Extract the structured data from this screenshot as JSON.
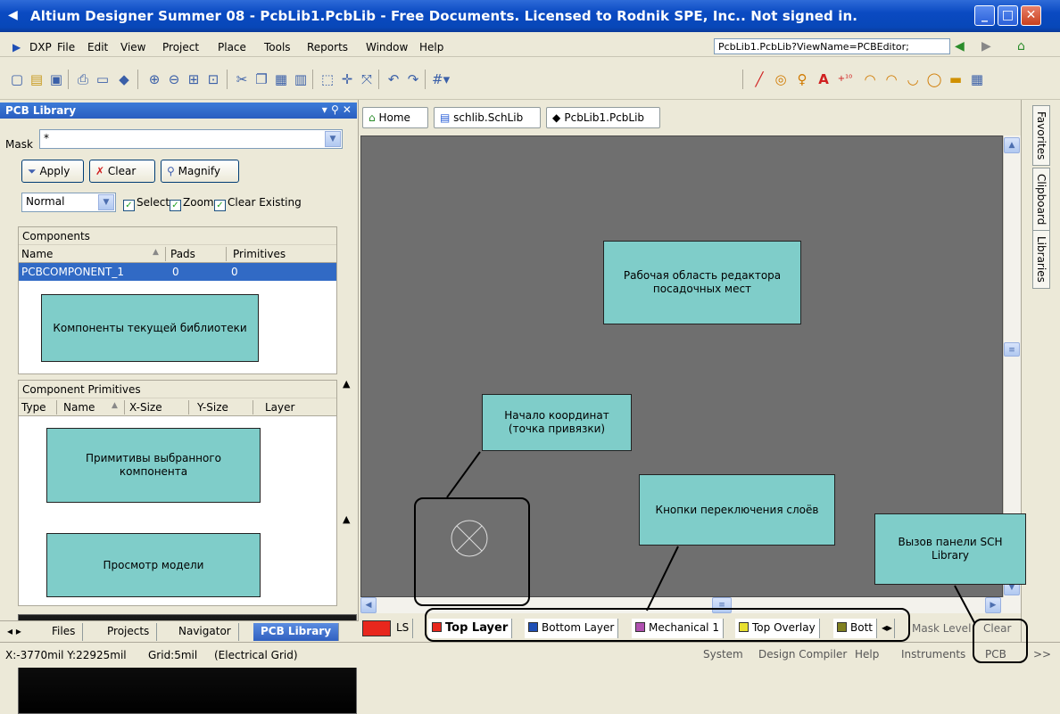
{
  "window": {
    "title": "Altium Designer Summer 08 - PcbLib1.PcbLib - Free Documents. Licensed to Rodnik SPE, Inc.. Not signed in."
  },
  "menubar": {
    "items": [
      "DXP",
      "File",
      "Edit",
      "View",
      "Project",
      "Place",
      "Tools",
      "Reports",
      "Window",
      "Help"
    ],
    "address": "PcbLib1.PcbLib?ViewName=PCBEditor;"
  },
  "panel": {
    "title": "PCB Library",
    "mask_label": "Mask",
    "mask_value": "*",
    "apply_label": "Apply",
    "clear_label": "Clear",
    "magnify_label": "Magnify",
    "mode_value": "Normal",
    "select_label": "Select",
    "zoom_label": "Zoom",
    "clear_existing_label": "Clear Existing",
    "components": {
      "title": "Components",
      "columns": [
        "Name",
        "Pads",
        "Primitives"
      ],
      "rows": [
        {
          "name": "PCBCOMPONENT_1",
          "pads": "0",
          "primitives": "0"
        }
      ]
    },
    "primitives": {
      "title": "Component Primitives",
      "columns": [
        "Type",
        "Name",
        "X-Size",
        "Y-Size",
        "Layer"
      ]
    }
  },
  "panel_tabs": [
    "Files",
    "Projects",
    "Navigator",
    "PCB Library"
  ],
  "doc_tabs": [
    "Home",
    "schlib.SchLib",
    "PcbLib1.PcbLib"
  ],
  "layer_tabs": [
    {
      "label": "LS",
      "color": "#e8271d"
    },
    {
      "label": "Top Layer",
      "color": "#e8271d"
    },
    {
      "label": "Bottom Layer",
      "color": "#1f4fb5"
    },
    {
      "label": "Mechanical 1",
      "color": "#b050b0"
    },
    {
      "label": "Top Overlay",
      "color": "#e8e030"
    },
    {
      "label": "Bott",
      "color": "#808020"
    }
  ],
  "layer_extra": {
    "mask_level": "Mask Level",
    "clear": "Clear"
  },
  "right_tabs": [
    "Favorites",
    "Clipboard",
    "Libraries"
  ],
  "status": {
    "coords": "X:-3770mil Y:22925mil",
    "grid": "Grid:5mil",
    "grid_type": "(Electrical Grid)",
    "buttons": [
      "System",
      "Design Compiler",
      "Help",
      "Instruments",
      "PCB",
      ">>"
    ]
  },
  "annotations": {
    "workspace": "Рабочая область редактора посадочных мест",
    "components": "Компоненты текущей библиотеки",
    "primitives": "Примитивы выбранного компонента",
    "preview": "Просмотр модели",
    "origin": "Начало координат (точка привязки)",
    "layers": "Кнопки переключения слоёв",
    "sch_library": "Вызов панели SCH Library"
  }
}
